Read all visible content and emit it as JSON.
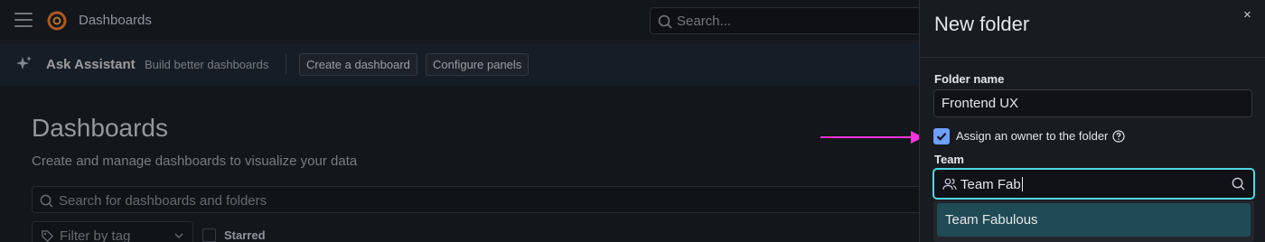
{
  "topbar": {
    "title": "Dashboards",
    "search_placeholder": "Search..."
  },
  "assistant": {
    "title": "Ask Assistant",
    "subtitle": "Build better dashboards",
    "actions": [
      "Create a dashboard",
      "Configure panels"
    ]
  },
  "page": {
    "title": "Dashboards",
    "subtitle": "Create and manage dashboards to visualize your data",
    "search_placeholder": "Search for dashboards and folders",
    "tag_filter_placeholder": "Filter by tag",
    "starred_label": "Starred"
  },
  "drawer": {
    "title": "New folder",
    "close_label": "×",
    "folder_name_label": "Folder name",
    "folder_name_value": "Frontend UX",
    "assign_owner_label": "Assign an owner to the folder",
    "assign_owner_checked": true,
    "team_label": "Team",
    "team_input_value": "Team Fab",
    "dropdown_options": [
      "Team Fabulous"
    ]
  },
  "colors": {
    "accent": "#6e9fff",
    "focus_border": "#4fd6e3",
    "option_highlight": "#1f4b55",
    "annotation_arrow": "#ff33dd"
  }
}
